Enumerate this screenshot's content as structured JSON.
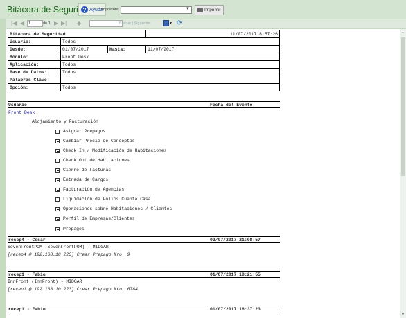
{
  "app": {
    "title": "Bitácora de Seguridad",
    "help_label": "Ayuda",
    "printer_label": "Impresora:",
    "printer_value": "",
    "print_label": "Imprimir"
  },
  "toolbar": {
    "page_value": "1",
    "page_of": "de 1",
    "search_value": "",
    "find_label": "Buscar",
    "separator": "|",
    "next_label": "Siguiente"
  },
  "report": {
    "title": "Bitácora de Seguridad",
    "datetime": "11/07/2017 8:57:26",
    "fields": {
      "usuario_label": "Usuario:",
      "usuario": "Todos",
      "desde_label": "Desde:",
      "desde": "01/07/2017",
      "hasta_label": "Hasta:",
      "hasta": "11/07/2017",
      "modulo_label": "Módulo:",
      "modulo": "Front Desk",
      "aplicacion_label": "Aplicación:",
      "aplicacion": "Todos",
      "base_label": "Base de Datos:",
      "base": "Todos",
      "palabras_label": "Palabras Clave:",
      "palabras": "",
      "opcion_label": "Opción:",
      "opcion": "Todos"
    },
    "col_usuario": "Usuario",
    "col_fecha": "Fecha del Evento",
    "group_level1": "Front Desk",
    "group_level2": "Alojamiento y Facturación",
    "items": [
      "Asignar Prepagos",
      "Cambiar Precio de Conceptos",
      "Check In / Modificación de Habitaciones",
      "Check Out de Habitaciones",
      "Cierre de Facturas",
      "Entrada de Cargos",
      "Facturación de Agencias",
      "Liquidación de Folios Cuenta Casa",
      "Operaciones sobre Habitaciones / Clientes",
      "Perfil de Empresas/Clientes",
      "Prepagos"
    ],
    "entries": [
      {
        "user": "recep4 - Cesar",
        "date": "02/07/2017 21:08:57",
        "line1": "SevenFrontPOM (SevenFrontPOM) - MIDGAR",
        "line2": "[recep4 @ 192.168.10.223] Crear Prepago Nro. 9"
      },
      {
        "user": "recep1 - Fabio",
        "date": "01/07/2017 18:21:55",
        "line1": "InnFront (InnFront) - MIDGAR",
        "line2": "[recep1 @ 192.168.10.223] Crear Prepago Nro. 6784"
      },
      {
        "user": "recep1 - Fabio",
        "date": "01/07/2017 16:37:23"
      }
    ]
  }
}
